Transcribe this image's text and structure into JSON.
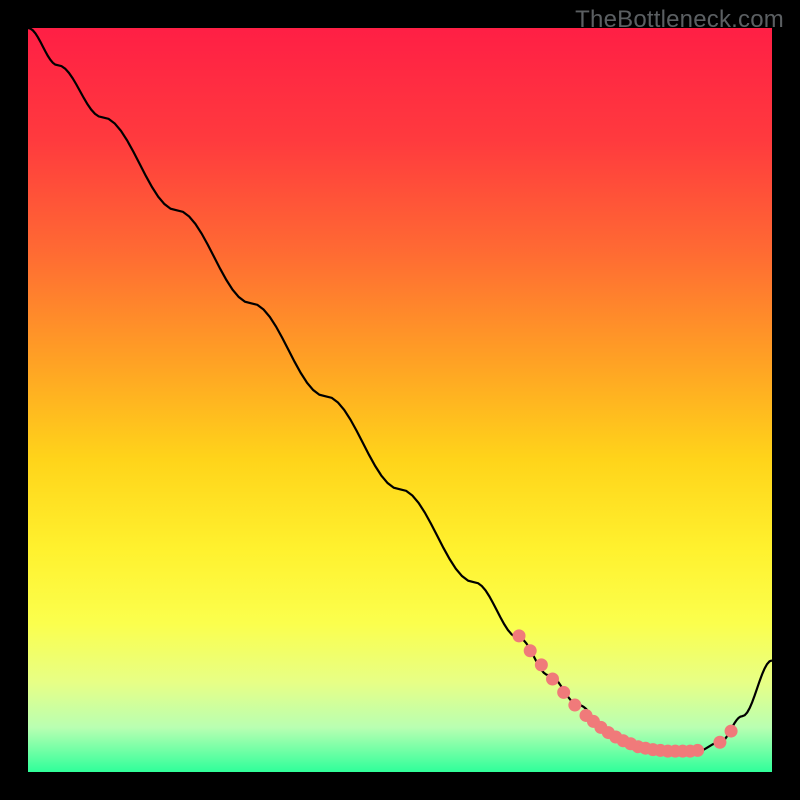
{
  "watermark": "TheBottleneck.com",
  "chart_data": {
    "type": "line",
    "title": "",
    "xlabel": "",
    "ylabel": "",
    "xlim": [
      0,
      100
    ],
    "ylim": [
      0,
      100
    ],
    "background_gradient": {
      "type": "vertical",
      "stops": [
        {
          "offset": 0.0,
          "color": "#ff1f45"
        },
        {
          "offset": 0.15,
          "color": "#ff3a3e"
        },
        {
          "offset": 0.3,
          "color": "#ff6a33"
        },
        {
          "offset": 0.45,
          "color": "#ffa224"
        },
        {
          "offset": 0.58,
          "color": "#ffd41a"
        },
        {
          "offset": 0.7,
          "color": "#fff12e"
        },
        {
          "offset": 0.8,
          "color": "#fbff4d"
        },
        {
          "offset": 0.88,
          "color": "#e7ff86"
        },
        {
          "offset": 0.94,
          "color": "#b9ffb2"
        },
        {
          "offset": 1.0,
          "color": "#2fff9a"
        }
      ]
    },
    "curve": {
      "name": "bottleneck-curve",
      "x": [
        0,
        4,
        10,
        20,
        30,
        40,
        50,
        60,
        66,
        70,
        74,
        78,
        82,
        86,
        90,
        93,
        96,
        100
      ],
      "y": [
        100,
        95,
        88,
        75.5,
        63,
        50.5,
        38,
        25.5,
        18,
        13,
        9,
        5.5,
        3.4,
        2.8,
        2.8,
        4,
        7.5,
        15
      ]
    },
    "markers": {
      "name": "highlight-markers",
      "color": "#f07a7a",
      "radius": 6.5,
      "points": [
        {
          "x": 66,
          "y": 18.3
        },
        {
          "x": 67.5,
          "y": 16.3
        },
        {
          "x": 69,
          "y": 14.4
        },
        {
          "x": 70.5,
          "y": 12.5
        },
        {
          "x": 72,
          "y": 10.7
        },
        {
          "x": 73.5,
          "y": 9.0
        },
        {
          "x": 75,
          "y": 7.6
        },
        {
          "x": 76,
          "y": 6.8
        },
        {
          "x": 77,
          "y": 6.0
        },
        {
          "x": 78,
          "y": 5.3
        },
        {
          "x": 79,
          "y": 4.7
        },
        {
          "x": 80,
          "y": 4.2
        },
        {
          "x": 81,
          "y": 3.8
        },
        {
          "x": 82,
          "y": 3.4
        },
        {
          "x": 83,
          "y": 3.2
        },
        {
          "x": 84,
          "y": 3.0
        },
        {
          "x": 85,
          "y": 2.9
        },
        {
          "x": 86,
          "y": 2.8
        },
        {
          "x": 87,
          "y": 2.8
        },
        {
          "x": 88,
          "y": 2.8
        },
        {
          "x": 89,
          "y": 2.8
        },
        {
          "x": 90,
          "y": 2.9
        },
        {
          "x": 93,
          "y": 4.0
        },
        {
          "x": 94.5,
          "y": 5.5
        }
      ]
    }
  }
}
